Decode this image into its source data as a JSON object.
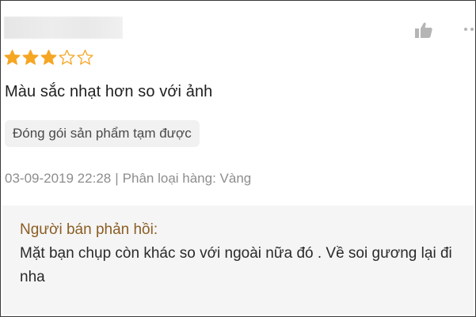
{
  "review": {
    "rating": 3,
    "rating_max": 5,
    "text": "Màu sắc nhạt hơn so với ảnh",
    "tag": "Đóng gói sản phẩm tạm được",
    "date": "03-09-2019 22:28",
    "separator": "|",
    "variation": "Phân loại hàng: Vàng"
  },
  "seller_response": {
    "title": "Người bán phản hồi:",
    "text": "Mặt bạn chụp còn khác so với ngoài nữa đó . Về soi gương lại đi nha"
  },
  "icons": {
    "like": "thumbs-up-icon",
    "more": "more-vertical-icon",
    "star": "star-icon"
  },
  "colors": {
    "star_filled": "#f5a623",
    "star_empty": "#f5a623",
    "seller_title": "#8b5d23",
    "meta": "#8d8d8d",
    "seller_box_bg": "#f5f5f5"
  }
}
